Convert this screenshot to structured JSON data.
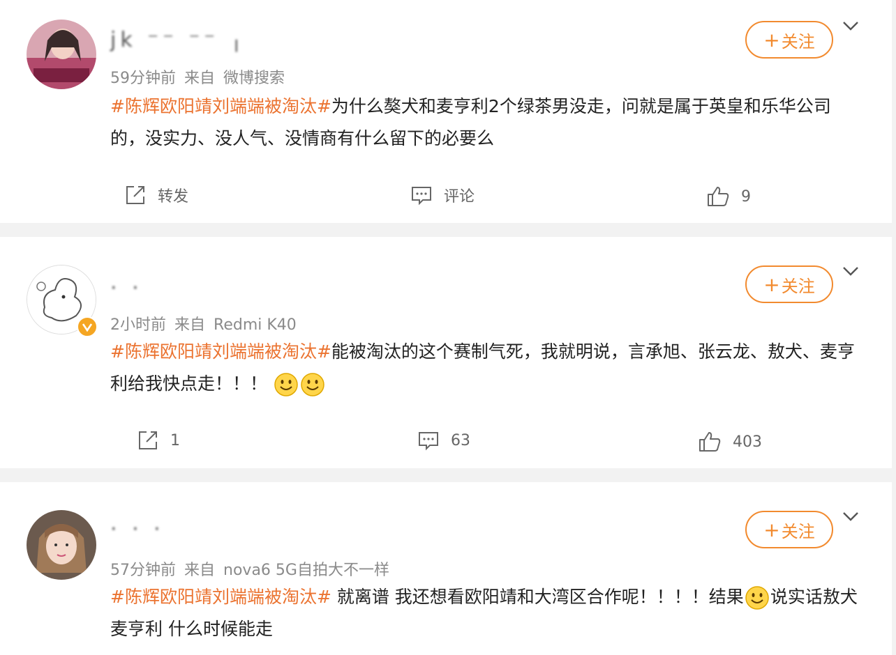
{
  "posts": [
    {
      "username": "jk ⁻⁻ ⁻⁻ ╷",
      "time": "59分钟前",
      "source_prefix": "来自",
      "source": "微博搜索",
      "follow_label": "关注",
      "topic": "#陈辉欧阳靖刘端端被淘汰#",
      "body": "为什么獒犬和麦亨利2个绿茶男没走，问就是属于英皇和乐华公司的，没实力、没人气、没情商有什么留下的必要么",
      "repost": "转发",
      "comment": "评论",
      "likes": "9",
      "verified": false
    },
    {
      "username": "· ·",
      "time": "2小时前",
      "source_prefix": "来自",
      "source": "Redmi K40",
      "follow_label": "关注",
      "topic": "#陈辉欧阳靖刘端端被淘汰#",
      "body": "能被淘汰的这个赛制气死，我就明说，言承旭、张云龙、敖犬、麦亨利给我快点走！！！",
      "repost": "1",
      "comment": "63",
      "likes": "403",
      "verified": true
    },
    {
      "username": "· · ·",
      "time": "57分钟前",
      "source_prefix": "来自",
      "source": "nova6 5G自拍大不一样",
      "follow_label": "关注",
      "topic": "#陈辉欧阳靖刘端端被淘汰#",
      "body_a": " 就离谱 我还想看欧阳靖和大湾区合作呢！！！！结果",
      "body_b": "说实话敖犬 麦亨利 什么时候能走",
      "verified": false
    }
  ],
  "colors": {
    "accent": "#f28a2e",
    "topic": "#eb7330",
    "meta": "#8a8a8a",
    "verified": "#f5a623"
  }
}
